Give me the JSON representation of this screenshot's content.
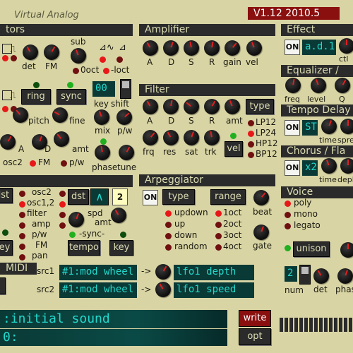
{
  "title": "Virtual Analog",
  "version": "V1.12 2010.5",
  "sections": {
    "osc": "tors",
    "amp": "Amplifier",
    "effect": "Effect",
    "eq": "Equalizer /",
    "filter": "Filter",
    "tempo_delay": "Tempo Delay",
    "chorus": "Chorus / Fla",
    "arp": "Arpeggiator",
    "voice": "Voice",
    "midi": "MIDI"
  },
  "osc": {
    "det": "det",
    "fm": "FM",
    "sub": "sub",
    "oct0": "0oct",
    "loct": "-loct",
    "ring": "ring",
    "sync": "sync",
    "pitch": "pitch",
    "fine": "fine",
    "key": "key",
    "shift": "shift",
    "shift_val": "00",
    "a": "A",
    "d": "D",
    "amt": "amt",
    "osc2": "osc2",
    "fm2": "FM",
    "pw": "p/w",
    "mix": "mix",
    "pw2": "p/w",
    "phase": "phase",
    "tune": "tune"
  },
  "amp": {
    "a": "A",
    "d": "D",
    "s": "S",
    "r": "R",
    "gain": "gain",
    "vel": "vel"
  },
  "filter": {
    "a": "A",
    "d": "D",
    "s": "S",
    "r": "R",
    "amt": "amt",
    "type": "type",
    "frq": "frq",
    "res": "res",
    "sat": "sat",
    "trk": "trk",
    "vel": "vel",
    "lp12": "LP12",
    "lp24": "LP24",
    "hp12": "HP12",
    "bp12": "BP12"
  },
  "effect": {
    "on": "ON",
    "name": "a.d.1",
    "ctl": "ctl"
  },
  "eq": {
    "freq": "freq",
    "level": "level",
    "q": "Q"
  },
  "tempo_delay": {
    "on": "ON",
    "st": "ST",
    "time": "time",
    "spread": "spre"
  },
  "chorus": {
    "on": "ON",
    "x2": "x2",
    "time": "time",
    "depth": "depl"
  },
  "mod": {
    "dst": "dst",
    "osc2": "osc2",
    "osc12": "osc1,2",
    "filter": "filter",
    "amp": "amp",
    "pw": "p/w",
    "fm": "FM",
    "pan": "pan",
    "dst2": "dst",
    "num": "2",
    "spd": "spd",
    "amt": "amt",
    "sync": "-sync-",
    "key": "key",
    "tempo": "tempo",
    "key2": "key"
  },
  "arp": {
    "on": "ON",
    "type": "type",
    "range": "range",
    "updown": "updown",
    "up": "up",
    "down": "down",
    "random": "random",
    "oct1": "1oct",
    "oct2": "2oct",
    "oct3": "3oct",
    "oct4": "4oct",
    "beat": "beat",
    "gate": "gate"
  },
  "voice": {
    "poly": "poly",
    "mono": "mono",
    "legato": "legato",
    "unison": "unison",
    "num_val": "2",
    "num": "num",
    "det": "det",
    "phase": "phas"
  },
  "midi": {
    "src1": "src1",
    "src1_val": "#1:mod wheel",
    "dst1": "lfo1 depth",
    "src2": "src2",
    "src2_val": "#1:mod wheel",
    "dst2": "lfo1 speed",
    "arrow": "->"
  },
  "patch": {
    "name": ":initial sound",
    "line2": "0:",
    "write": "write",
    "opt": "opt"
  }
}
